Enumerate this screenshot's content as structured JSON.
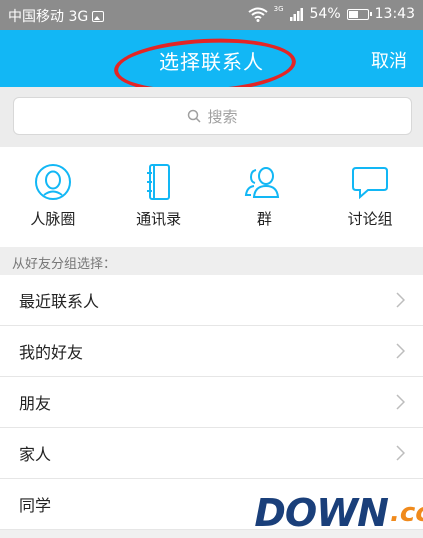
{
  "status_bar": {
    "carrier": "中国移动 3G",
    "signal_label": "3G",
    "battery": "54%",
    "time": "13:43"
  },
  "header": {
    "title": "选择联系人",
    "cancel": "取消"
  },
  "search": {
    "placeholder": "搜索"
  },
  "quick_nav": [
    {
      "label": "人脉圈",
      "icon": "face-circle-icon"
    },
    {
      "label": "通讯录",
      "icon": "address-book-icon"
    },
    {
      "label": "群",
      "icon": "group-icon"
    },
    {
      "label": "讨论组",
      "icon": "chat-bubble-icon"
    }
  ],
  "section": {
    "header": "从好友分组选择："
  },
  "groups": [
    {
      "label": "最近联系人"
    },
    {
      "label": "我的好友"
    },
    {
      "label": "朋友"
    },
    {
      "label": "家人"
    },
    {
      "label": "同学"
    }
  ],
  "watermark": {
    "text": "DOWN",
    "suffix": ".cc"
  },
  "colors": {
    "accent": "#12b7f5",
    "highlight": "#e32525",
    "status_bar": "#8c8c8c"
  }
}
